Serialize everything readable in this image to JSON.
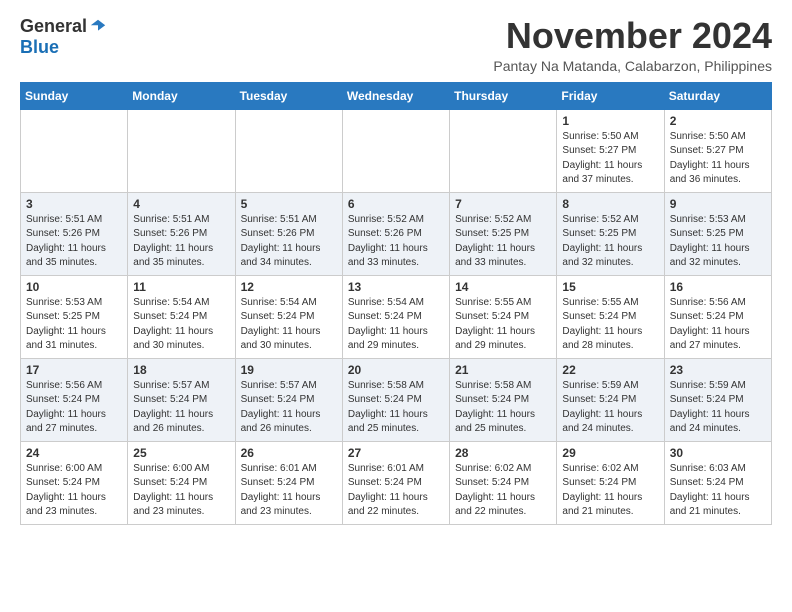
{
  "logo": {
    "general": "General",
    "blue": "Blue"
  },
  "header": {
    "month": "November 2024",
    "location": "Pantay Na Matanda, Calabarzon, Philippines"
  },
  "days_of_week": [
    "Sunday",
    "Monday",
    "Tuesday",
    "Wednesday",
    "Thursday",
    "Friday",
    "Saturday"
  ],
  "weeks": [
    [
      {
        "day": "",
        "sunrise": "",
        "sunset": "",
        "daylight": ""
      },
      {
        "day": "",
        "sunrise": "",
        "sunset": "",
        "daylight": ""
      },
      {
        "day": "",
        "sunrise": "",
        "sunset": "",
        "daylight": ""
      },
      {
        "day": "",
        "sunrise": "",
        "sunset": "",
        "daylight": ""
      },
      {
        "day": "",
        "sunrise": "",
        "sunset": "",
        "daylight": ""
      },
      {
        "day": "1",
        "sunrise": "Sunrise: 5:50 AM",
        "sunset": "Sunset: 5:27 PM",
        "daylight": "Daylight: 11 hours and 37 minutes."
      },
      {
        "day": "2",
        "sunrise": "Sunrise: 5:50 AM",
        "sunset": "Sunset: 5:27 PM",
        "daylight": "Daylight: 11 hours and 36 minutes."
      }
    ],
    [
      {
        "day": "3",
        "sunrise": "Sunrise: 5:51 AM",
        "sunset": "Sunset: 5:26 PM",
        "daylight": "Daylight: 11 hours and 35 minutes."
      },
      {
        "day": "4",
        "sunrise": "Sunrise: 5:51 AM",
        "sunset": "Sunset: 5:26 PM",
        "daylight": "Daylight: 11 hours and 35 minutes."
      },
      {
        "day": "5",
        "sunrise": "Sunrise: 5:51 AM",
        "sunset": "Sunset: 5:26 PM",
        "daylight": "Daylight: 11 hours and 34 minutes."
      },
      {
        "day": "6",
        "sunrise": "Sunrise: 5:52 AM",
        "sunset": "Sunset: 5:26 PM",
        "daylight": "Daylight: 11 hours and 33 minutes."
      },
      {
        "day": "7",
        "sunrise": "Sunrise: 5:52 AM",
        "sunset": "Sunset: 5:25 PM",
        "daylight": "Daylight: 11 hours and 33 minutes."
      },
      {
        "day": "8",
        "sunrise": "Sunrise: 5:52 AM",
        "sunset": "Sunset: 5:25 PM",
        "daylight": "Daylight: 11 hours and 32 minutes."
      },
      {
        "day": "9",
        "sunrise": "Sunrise: 5:53 AM",
        "sunset": "Sunset: 5:25 PM",
        "daylight": "Daylight: 11 hours and 32 minutes."
      }
    ],
    [
      {
        "day": "10",
        "sunrise": "Sunrise: 5:53 AM",
        "sunset": "Sunset: 5:25 PM",
        "daylight": "Daylight: 11 hours and 31 minutes."
      },
      {
        "day": "11",
        "sunrise": "Sunrise: 5:54 AM",
        "sunset": "Sunset: 5:24 PM",
        "daylight": "Daylight: 11 hours and 30 minutes."
      },
      {
        "day": "12",
        "sunrise": "Sunrise: 5:54 AM",
        "sunset": "Sunset: 5:24 PM",
        "daylight": "Daylight: 11 hours and 30 minutes."
      },
      {
        "day": "13",
        "sunrise": "Sunrise: 5:54 AM",
        "sunset": "Sunset: 5:24 PM",
        "daylight": "Daylight: 11 hours and 29 minutes."
      },
      {
        "day": "14",
        "sunrise": "Sunrise: 5:55 AM",
        "sunset": "Sunset: 5:24 PM",
        "daylight": "Daylight: 11 hours and 29 minutes."
      },
      {
        "day": "15",
        "sunrise": "Sunrise: 5:55 AM",
        "sunset": "Sunset: 5:24 PM",
        "daylight": "Daylight: 11 hours and 28 minutes."
      },
      {
        "day": "16",
        "sunrise": "Sunrise: 5:56 AM",
        "sunset": "Sunset: 5:24 PM",
        "daylight": "Daylight: 11 hours and 27 minutes."
      }
    ],
    [
      {
        "day": "17",
        "sunrise": "Sunrise: 5:56 AM",
        "sunset": "Sunset: 5:24 PM",
        "daylight": "Daylight: 11 hours and 27 minutes."
      },
      {
        "day": "18",
        "sunrise": "Sunrise: 5:57 AM",
        "sunset": "Sunset: 5:24 PM",
        "daylight": "Daylight: 11 hours and 26 minutes."
      },
      {
        "day": "19",
        "sunrise": "Sunrise: 5:57 AM",
        "sunset": "Sunset: 5:24 PM",
        "daylight": "Daylight: 11 hours and 26 minutes."
      },
      {
        "day": "20",
        "sunrise": "Sunrise: 5:58 AM",
        "sunset": "Sunset: 5:24 PM",
        "daylight": "Daylight: 11 hours and 25 minutes."
      },
      {
        "day": "21",
        "sunrise": "Sunrise: 5:58 AM",
        "sunset": "Sunset: 5:24 PM",
        "daylight": "Daylight: 11 hours and 25 minutes."
      },
      {
        "day": "22",
        "sunrise": "Sunrise: 5:59 AM",
        "sunset": "Sunset: 5:24 PM",
        "daylight": "Daylight: 11 hours and 24 minutes."
      },
      {
        "day": "23",
        "sunrise": "Sunrise: 5:59 AM",
        "sunset": "Sunset: 5:24 PM",
        "daylight": "Daylight: 11 hours and 24 minutes."
      }
    ],
    [
      {
        "day": "24",
        "sunrise": "Sunrise: 6:00 AM",
        "sunset": "Sunset: 5:24 PM",
        "daylight": "Daylight: 11 hours and 23 minutes."
      },
      {
        "day": "25",
        "sunrise": "Sunrise: 6:00 AM",
        "sunset": "Sunset: 5:24 PM",
        "daylight": "Daylight: 11 hours and 23 minutes."
      },
      {
        "day": "26",
        "sunrise": "Sunrise: 6:01 AM",
        "sunset": "Sunset: 5:24 PM",
        "daylight": "Daylight: 11 hours and 23 minutes."
      },
      {
        "day": "27",
        "sunrise": "Sunrise: 6:01 AM",
        "sunset": "Sunset: 5:24 PM",
        "daylight": "Daylight: 11 hours and 22 minutes."
      },
      {
        "day": "28",
        "sunrise": "Sunrise: 6:02 AM",
        "sunset": "Sunset: 5:24 PM",
        "daylight": "Daylight: 11 hours and 22 minutes."
      },
      {
        "day": "29",
        "sunrise": "Sunrise: 6:02 AM",
        "sunset": "Sunset: 5:24 PM",
        "daylight": "Daylight: 11 hours and 21 minutes."
      },
      {
        "day": "30",
        "sunrise": "Sunrise: 6:03 AM",
        "sunset": "Sunset: 5:24 PM",
        "daylight": "Daylight: 11 hours and 21 minutes."
      }
    ]
  ]
}
